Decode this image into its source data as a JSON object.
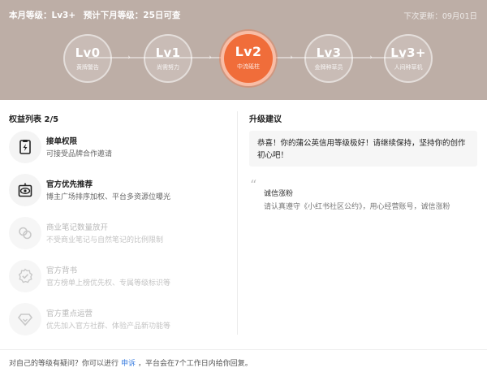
{
  "header": {
    "current_level_text": "本月等级：Lv3+",
    "forecast_text": "预计下月等级：25日可查",
    "next_update": "下次更新：09月01日"
  },
  "levels": [
    {
      "name": "Lv0",
      "sub": "黄牌警告"
    },
    {
      "name": "Lv1",
      "sub": "尚需努力"
    },
    {
      "name": "Lv2",
      "sub": "中流砥柱"
    },
    {
      "name": "Lv3",
      "sub": "金牌种草员"
    },
    {
      "name": "Lv3+",
      "sub": "人间种草机"
    }
  ],
  "benefits": {
    "title": "权益列表 2/5",
    "items": [
      {
        "title": "接单权限",
        "desc": "可接受品牌合作邀请",
        "icon": "lightning-doc-icon",
        "enabled": true
      },
      {
        "title": "官方优先推荐",
        "desc": "博主广场排序加权、平台多资源位曝光",
        "icon": "eye-icon",
        "enabled": true
      },
      {
        "title": "商业笔记数量放开",
        "desc": "不受商业笔记与自然笔记的比例限制",
        "icon": "link-icon",
        "enabled": false
      },
      {
        "title": "官方背书",
        "desc": "官方榜单上榜优先权、专属等级标识等",
        "icon": "badge-check-icon",
        "enabled": false
      },
      {
        "title": "官方重点运营",
        "desc": "优先加入官方社群、体验产品新功能等",
        "icon": "diamond-icon",
        "enabled": false
      }
    ]
  },
  "suggestion": {
    "title": "升级建议",
    "congrats": "恭喜！你的蒲公英信用等级极好！请继续保持，坚持你的创作初心吧！",
    "tip_title": "诚信涨粉",
    "tip_desc": "请认真遵守《小红书社区公约》，用心经营账号，诚信涨粉"
  },
  "footer": {
    "prefix": "对自己的等级有疑问？你可以进行",
    "link": "申诉",
    "suffix": "，平台会在7个工作日内给你回复。"
  },
  "colors": {
    "header_bg": "#bdaea6",
    "active_level": "#f06d3a",
    "link": "#3d7fe0"
  }
}
